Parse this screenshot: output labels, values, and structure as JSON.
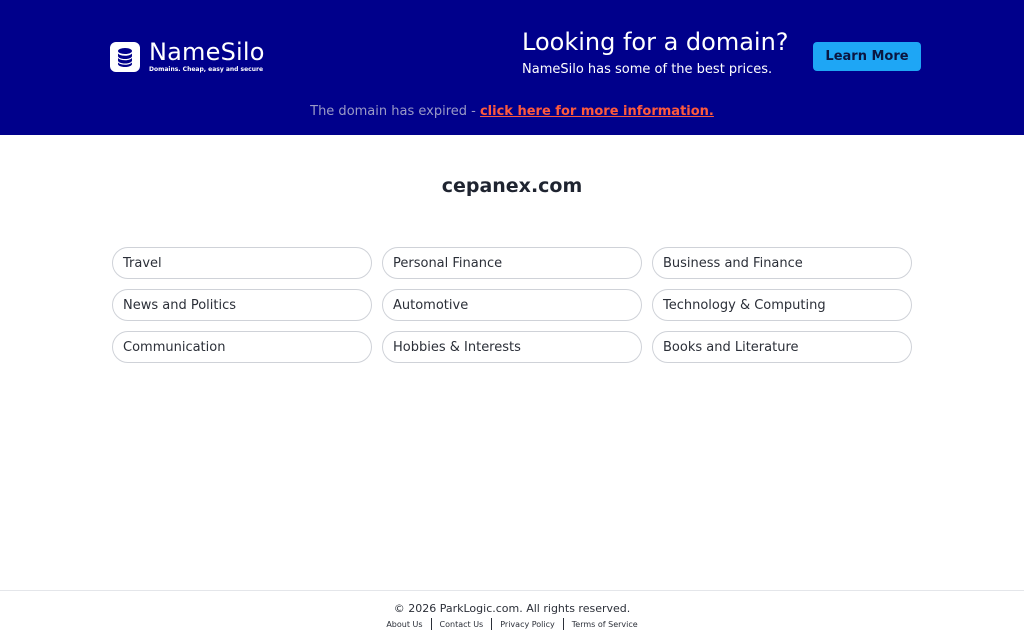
{
  "banner": {
    "logo": {
      "name": "NameSilo",
      "tagline": "Domains. Cheap, easy and secure",
      "icon": "database-icon"
    },
    "promo_title": "Looking for a domain?",
    "promo_subtitle": "NameSilo has some of the best prices.",
    "learn_more_label": "Learn More",
    "expired_text": "The domain has expired - ",
    "expired_link": "click here for more information.",
    "colors": {
      "background": "#00008b",
      "button": "#1ea6f5",
      "link": "#ff5a3c"
    }
  },
  "main": {
    "domain": "cepanex.com",
    "categories": [
      {
        "label": "Travel"
      },
      {
        "label": "Personal Finance"
      },
      {
        "label": "Business and Finance"
      },
      {
        "label": "News and Politics"
      },
      {
        "label": "Automotive"
      },
      {
        "label": "Technology & Computing"
      },
      {
        "label": "Communication"
      },
      {
        "label": "Hobbies & Interests"
      },
      {
        "label": "Books and Literature"
      }
    ]
  },
  "footer": {
    "copyright": "© 2026 ParkLogic.com. All rights reserved.",
    "links": [
      {
        "label": "About Us"
      },
      {
        "label": "Contact Us"
      },
      {
        "label": "Privacy Policy"
      },
      {
        "label": "Terms of Service"
      }
    ]
  }
}
